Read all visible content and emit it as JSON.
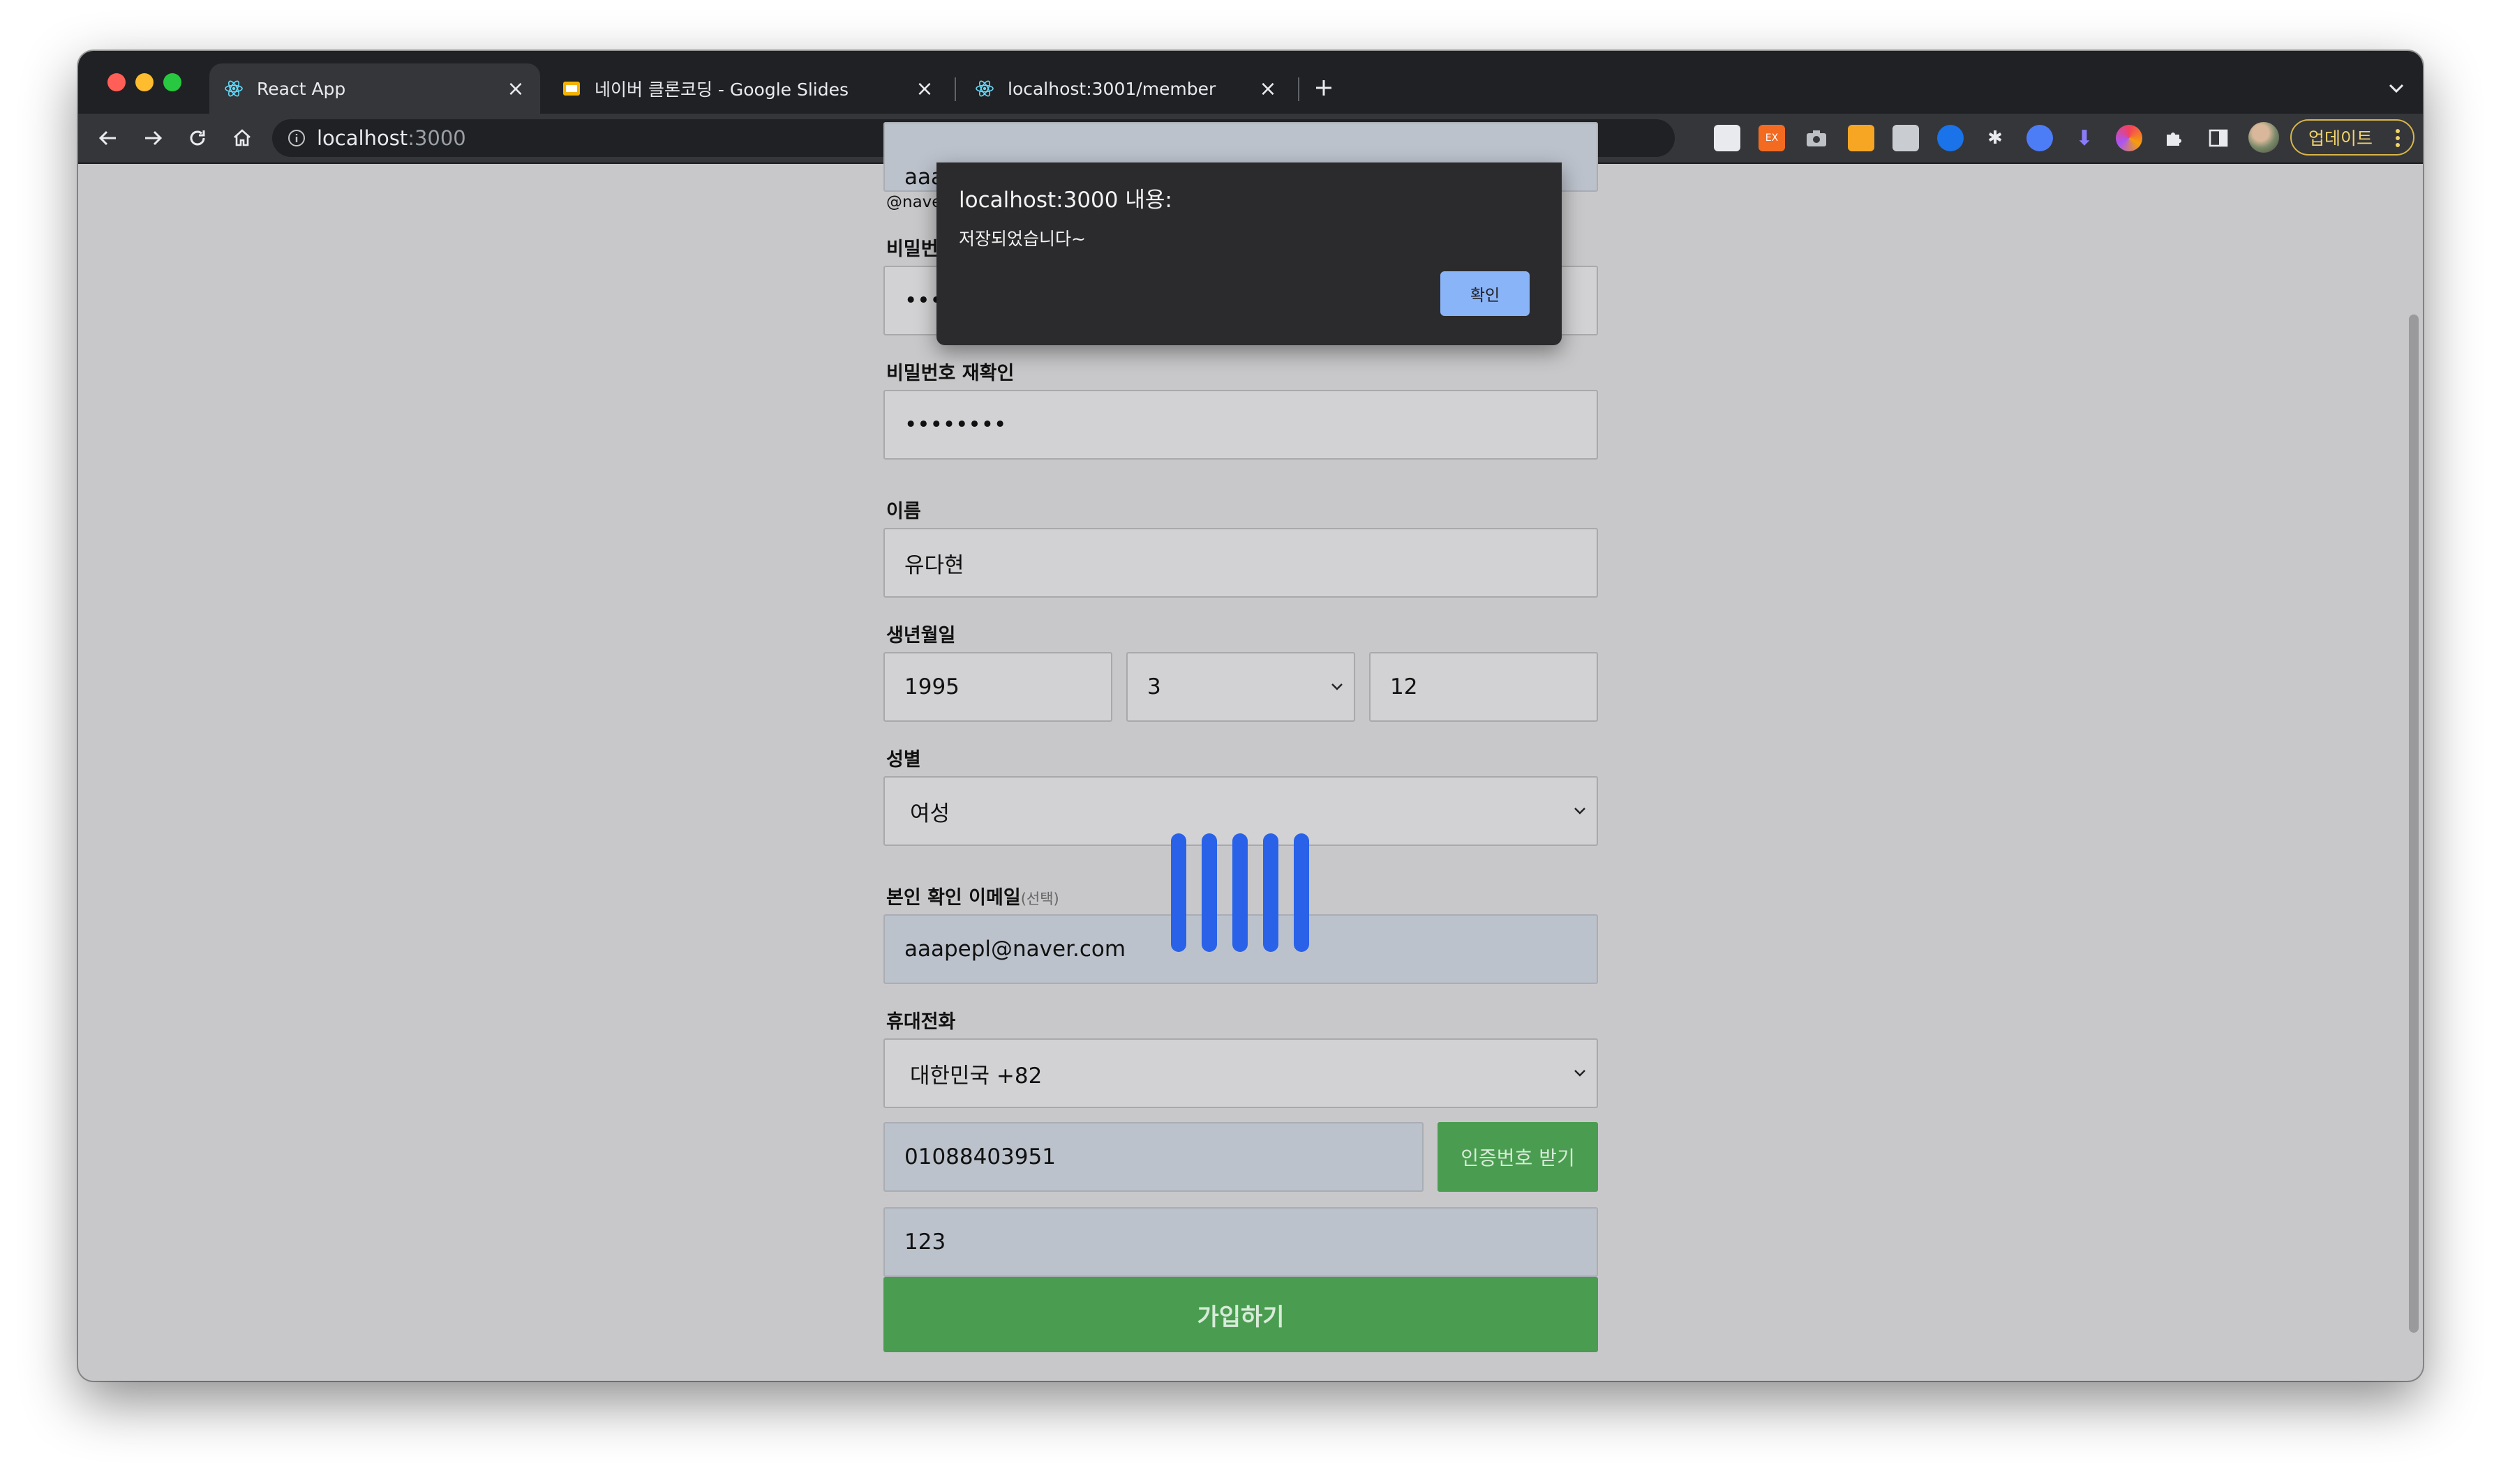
{
  "browser": {
    "tabs": [
      {
        "title": "React App",
        "icon": "react-icon",
        "active": true
      },
      {
        "title": "네이버 클론코딩 - Google Slides",
        "icon": "google-slides-icon",
        "active": false
      },
      {
        "title": "localhost:3001/member",
        "icon": "react-icon",
        "active": false
      }
    ],
    "address": {
      "host": "localhost",
      "port": ":3000"
    },
    "update_label": "업데이트",
    "colors": {
      "frame": "#202124",
      "toolbar": "#35363a",
      "update_border": "#d8b54a"
    }
  },
  "dialog": {
    "title": "localhost:3000 내용:",
    "message": "저장되었습니다~",
    "ok_label": "확인",
    "ok_color": "#8ab4f8"
  },
  "form": {
    "id_partial": "aaa",
    "id_hint_partial": "@nave",
    "password_label_partial": "비밀번",
    "password_value": "••••••",
    "password_confirm_label": "비밀번호 재확인",
    "password_confirm_value": "••••••••",
    "name_label": "이름",
    "name_value": "유다현",
    "birth_label": "생년월일",
    "birth_year": "1995",
    "birth_month": "3",
    "birth_day": "12",
    "gender_label": "성별",
    "gender_value": "여성",
    "email_label": "본인 확인 이메일",
    "email_optional": "(선택)",
    "email_value": "aaapepl@naver.com",
    "phone_label": "휴대전화",
    "country_value": "대한민국 +82",
    "phone_value": "01088403951",
    "verify_button": "인증번호 받기",
    "code_value": "123",
    "submit_button": "가입하기",
    "colors": {
      "green": "#4a9d50",
      "field": "#d2d2d4",
      "autofill": "#bcc2cc",
      "loader": "#2962e8"
    }
  }
}
